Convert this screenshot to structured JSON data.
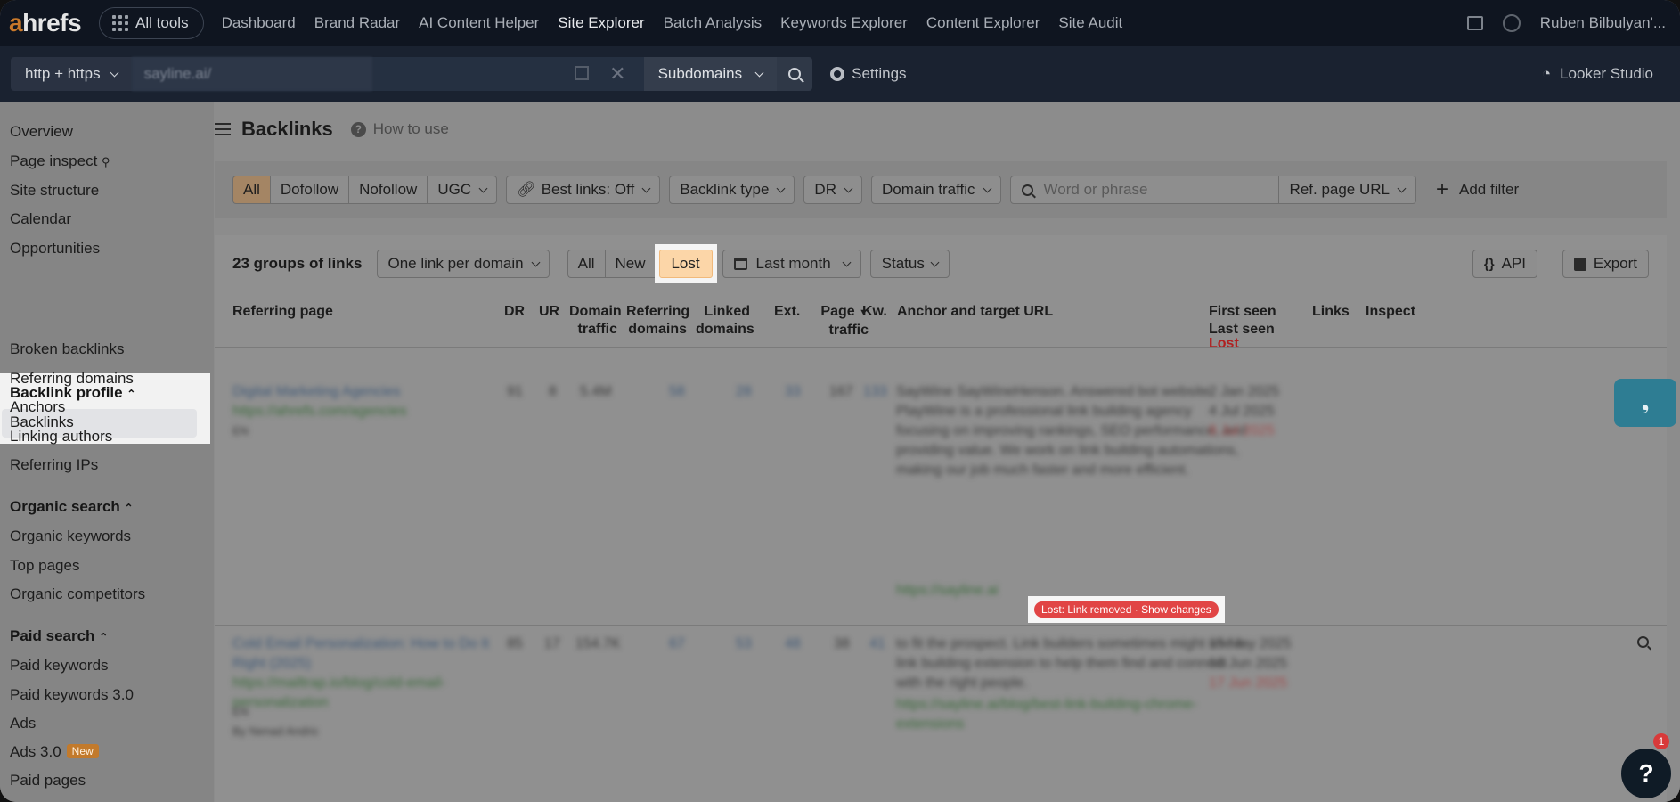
{
  "topnav": {
    "logo_accent": "a",
    "logo_rest": "hrefs",
    "all_tools": "All tools",
    "links": [
      "Dashboard",
      "Brand Radar",
      "AI Content Helper",
      "Site Explorer",
      "Batch Analysis",
      "Keywords Explorer",
      "Content Explorer",
      "Site Audit"
    ],
    "active_link": "Site Explorer",
    "user": "Ruben Bilbulyan'..."
  },
  "searchbar": {
    "protocol": "http + https",
    "url": "sayline.ai/",
    "mode": "Subdomains",
    "settings": "Settings",
    "looker": "Looker Studio"
  },
  "sidebar": {
    "items_top": [
      "Overview",
      "Page inspect",
      "Site structure",
      "Calendar",
      "Opportunities"
    ],
    "backlink_header": "Backlink profile",
    "backlink_items": [
      "Backlinks",
      "Broken backlinks",
      "Referring domains",
      "Anchors",
      "Linking authors",
      "Referring IPs"
    ],
    "organic_header": "Organic search",
    "organic_items": [
      "Organic keywords",
      "Top pages",
      "Organic competitors"
    ],
    "paid_header": "Paid search",
    "paid_items": [
      "Paid keywords",
      "Paid keywords 3.0",
      "Ads",
      "Ads 3.0",
      "Paid pages"
    ],
    "new_badge": "New"
  },
  "main": {
    "title": "Backlinks",
    "how_to_use": "How to use",
    "filters": {
      "all": "All",
      "dofollow": "Dofollow",
      "nofollow": "Nofollow",
      "ugc": "UGC",
      "best_links": "Best links: Off",
      "backlink_type": "Backlink type",
      "dr": "DR",
      "domain_traffic": "Domain traffic",
      "search_placeholder": "Word or phrase",
      "ref_page_url": "Ref. page URL",
      "add_filter": "Add filter"
    },
    "toolbar": {
      "groups": "23 groups of links",
      "grouping": "One link per domain",
      "seg_all": "All",
      "seg_new": "New",
      "seg_lost": "Lost",
      "date": "Last month",
      "status": "Status",
      "api": "API",
      "export": "Export"
    },
    "columns": {
      "referring_page": "Referring page",
      "dr": "DR",
      "ur": "UR",
      "domain_traffic_1": "Domain",
      "domain_traffic_2": "traffic",
      "ref_domains_1": "Referring",
      "ref_domains_2": "domains",
      "linked_domains_1": "Linked",
      "linked_domains_2": "domains",
      "ext": "Ext.",
      "page_traffic_1": "Page",
      "page_traffic_2": "traffic",
      "kw": "Kw.",
      "anchor": "Anchor and target URL",
      "first_seen": "First seen",
      "last_seen": "Last seen",
      "lost": "Lost",
      "links": "Links",
      "inspect": "Inspect"
    },
    "rows": [
      {
        "title": "Digital Marketing Agencies",
        "url": "https://ahrefs.com/agencies",
        "lang": "EN",
        "dr": "91",
        "ur": "8",
        "domain_traffic": "5.4M",
        "ref_domains": "58",
        "linked_domains": "28",
        "ext": "33",
        "page_traffic": "167",
        "kw": "133",
        "anchor": "SayWine SayWineHenson. Answered bot website. PlayWine is a professional link building agency focusing on improving rankings, SEO performance, and providing value. We work on link building automations, making our job much faster and more efficient.",
        "target": "https://sayline.ai",
        "first_seen": "2 Jan 2025",
        "last_seen": "4 Jul 2025",
        "lost_date": "8 Jul 2025",
        "lost_label": "Lost: Link removed",
        "show_changes": "Show changes"
      },
      {
        "title": "Cold Email Personalization: How to Do It Right (2025)",
        "url": "https://mailtrap.io/blog/cold-email-personalization",
        "lang": "EN",
        "dr": "85",
        "ur": "17",
        "domain_traffic": "154.7K",
        "ref_domains": "67",
        "linked_domains": "53",
        "ext": "48",
        "page_traffic": "38",
        "kw": "41",
        "anchor": "to fit the prospect. Link builders sometimes might use a link building extension to help them find and connect with the right people.",
        "target": "https://sayline.ai/blog/best-link-building-chrome-extensions",
        "first_seen": "15 May 2025",
        "last_seen": "16 Jun 2025",
        "lost_date": "17 Jun 2025",
        "author": "By Nenad Andric"
      }
    ]
  },
  "widgets": {
    "help": "?",
    "notifications": "1"
  }
}
